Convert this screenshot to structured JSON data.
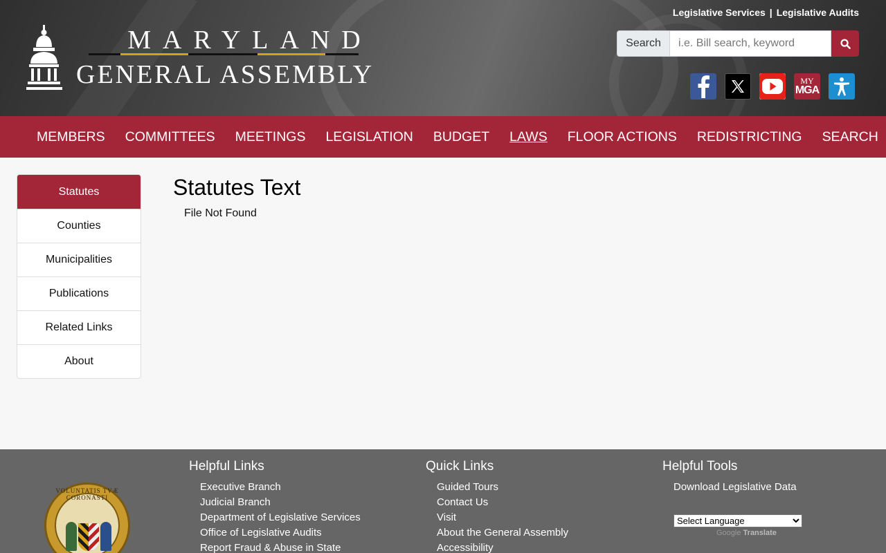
{
  "header": {
    "logo_top": "MARYLAND",
    "logo_bottom": "GENERAL ASSEMBLY",
    "top_links": [
      "Legislative Services",
      "Legislative Audits"
    ],
    "top_link_separator": "|",
    "search": {
      "label": "Search",
      "placeholder": "i.e. Bill search, keyword"
    },
    "social": [
      {
        "name": "facebook-icon"
      },
      {
        "name": "x-icon"
      },
      {
        "name": "youtube-icon"
      },
      {
        "name": "mymga-icon",
        "text_top": "MY",
        "text_bottom": "MGA"
      },
      {
        "name": "accessibility-icon"
      }
    ]
  },
  "nav": {
    "items": [
      "MEMBERS",
      "COMMITTEES",
      "MEETINGS",
      "LEGISLATION",
      "BUDGET",
      "LAWS",
      "FLOOR ACTIONS",
      "REDISTRICTING",
      "SEARCH"
    ],
    "active": "LAWS"
  },
  "sidebar": {
    "items": [
      "Statutes",
      "Counties",
      "Municipalities",
      "Publications",
      "Related Links",
      "About"
    ],
    "active": "Statutes"
  },
  "main": {
    "title": "Statutes Text",
    "message": "File Not Found"
  },
  "footer": {
    "seal_text": "VOLUNTATIS TVÆ CORONASTI",
    "helpful_links": {
      "title": "Helpful Links",
      "items": [
        "Executive Branch",
        "Judicial Branch",
        "Department of Legislative Services",
        "Office of Legislative Audits",
        "Report Fraud & Abuse in State"
      ]
    },
    "quick_links": {
      "title": "Quick Links",
      "items": [
        "Guided Tours",
        "Contact Us",
        "Visit",
        "About the General Assembly",
        "Accessibility"
      ]
    },
    "helpful_tools": {
      "title": "Helpful Tools",
      "items": [
        "Download Legislative Data"
      ],
      "language_select": "Select Language",
      "powered_by_google": "Google",
      "powered_by_translate": "Translate"
    }
  },
  "colors": {
    "brand": "#a32638",
    "footer": "#666666",
    "gold": "#d2a21f"
  }
}
